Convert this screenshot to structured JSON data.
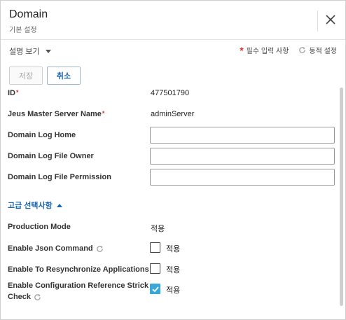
{
  "header": {
    "title": "Domain",
    "subtitle": "기본 설정"
  },
  "subbar": {
    "view_toggle": "설명 보기",
    "legend_required": "필수 입력 사항",
    "legend_dynamic": "동적 설정"
  },
  "actions": {
    "save_label": "저장",
    "cancel_label": "취소"
  },
  "fields": {
    "id": {
      "label": "ID",
      "value": "477501790"
    },
    "master_server": {
      "label": "Jeus Master Server Name",
      "value": "adminServer"
    },
    "log_home": {
      "label": "Domain Log Home",
      "value": ""
    },
    "log_owner": {
      "label": "Domain Log File Owner",
      "value": ""
    },
    "log_permission": {
      "label": "Domain Log File Permission",
      "value": ""
    }
  },
  "advanced": {
    "toggle_label": "고급 선택사항",
    "production_mode": {
      "label": "Production Mode",
      "value": "적용"
    },
    "json_command": {
      "label": "Enable Json Command",
      "checkbox_label": "적용",
      "checked": false
    },
    "resync_apps": {
      "label": "Enable To Resynchronize Applications",
      "checkbox_label": "적용",
      "checked": false
    },
    "config_ref_check": {
      "label_line1": "Enable Configuration Reference Strick",
      "label_line2": "Check",
      "checkbox_label": "적용",
      "checked": true
    }
  },
  "colors": {
    "accent": "#1a66b0",
    "required": "#d9302f",
    "checkbox_checked": "#3aa7d9"
  }
}
